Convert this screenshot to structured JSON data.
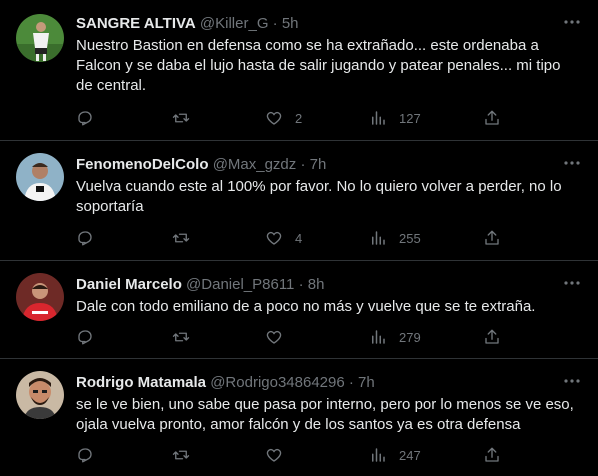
{
  "tweets": [
    {
      "name": "SANGRE ALTIVA",
      "handle": "@Killer_G",
      "separator": "·",
      "time": "5h",
      "text": "Nuestro Bastion en defensa como se ha extrañado... este ordenaba a Falcon y se daba el lujo hasta de salir jugando y patear penales... mi tipo de central.",
      "replies": "",
      "retweets": "",
      "likes": "2",
      "views": "127"
    },
    {
      "name": "FenomenoDelColo",
      "handle": "@Max_gzdz",
      "separator": "·",
      "time": "7h",
      "text": "Vuelva cuando este al 100% por favor. No lo quiero volver a perder, no lo soportaría",
      "replies": "",
      "retweets": "",
      "likes": "4",
      "views": "255"
    },
    {
      "name": "Daniel Marcelo",
      "handle": "@Daniel_P8611",
      "separator": "·",
      "time": "8h",
      "text": "Dale con todo emiliano de a poco no más y vuelve que se te extraña.",
      "replies": "",
      "retweets": "",
      "likes": "",
      "views": "279"
    },
    {
      "name": "Rodrigo Matamala",
      "handle": "@Rodrigo34864296",
      "separator": "·",
      "time": "7h",
      "text": "se le ve bien, uno sabe que pasa por interno, pero por lo menos se ve eso, ojala vuelva pronto, amor falcón y de los santos ya es otra defensa",
      "replies": "",
      "retweets": "",
      "likes": "",
      "views": "247"
    }
  ],
  "icons": {
    "more": "more-horizontal-icon",
    "reply": "reply-icon",
    "retweet": "retweet-icon",
    "like": "heart-icon",
    "views": "views-chart-icon",
    "share": "share-icon"
  },
  "colors": {
    "background": "#000000",
    "text": "#e7e9ea",
    "muted": "#71767b",
    "border": "#2f3336"
  }
}
